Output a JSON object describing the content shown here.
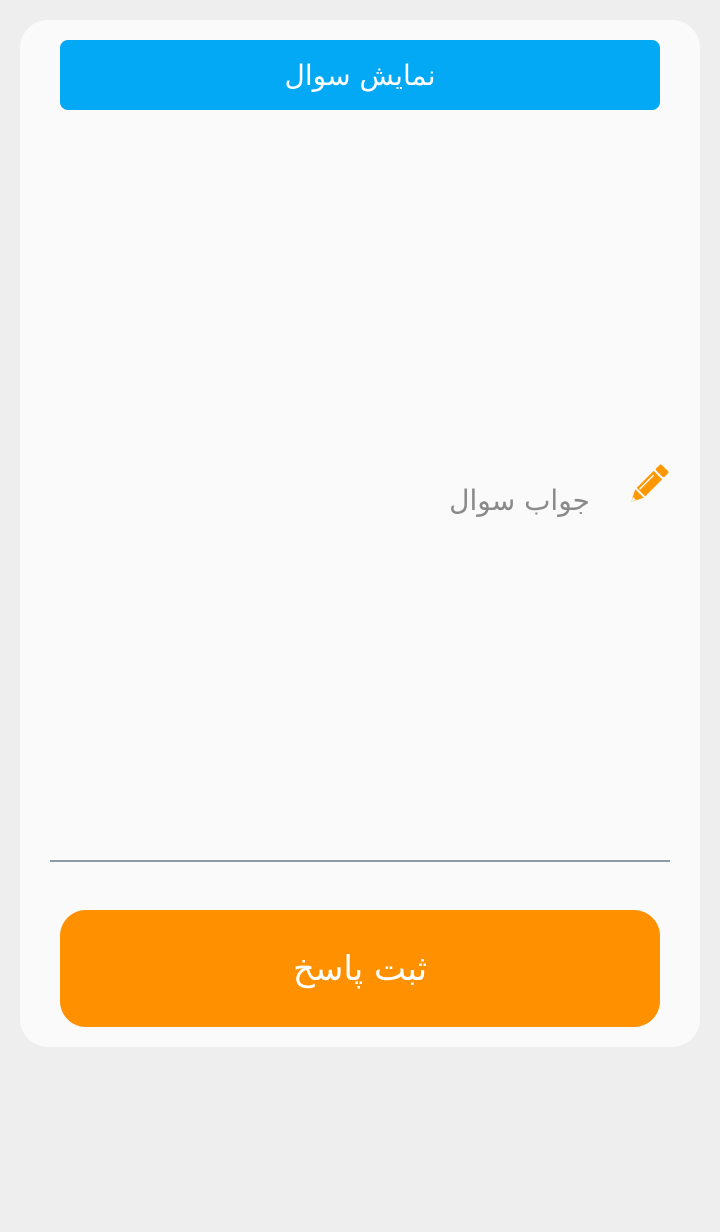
{
  "buttons": {
    "show_question": "نمایش سوال",
    "submit_answer": "ثبت پاسخ"
  },
  "answer": {
    "placeholder": "جواب سوال",
    "value": "",
    "icon": "pencil-icon"
  },
  "colors": {
    "show_question_bg": "#03a9f4",
    "submit_bg": "#ff9100",
    "pencil": "#ff9800",
    "underline": "#8e9aa6"
  }
}
